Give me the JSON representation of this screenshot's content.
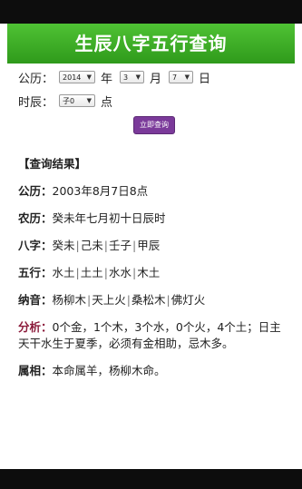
{
  "header": {
    "title": "生辰八字五行查询"
  },
  "form": {
    "calendar_label": "公历：",
    "year_value": "2014",
    "year_unit": "年",
    "month_value": "3",
    "month_unit": "月",
    "day_value": "7",
    "day_unit": "日",
    "hour_label": "时辰：",
    "hour_value": "子0",
    "hour_unit": "点",
    "query_button": "立即查询"
  },
  "result": {
    "title": "【查询结果】",
    "gongli": {
      "label": "公历：",
      "value": "2003年8月7日8点"
    },
    "nongli": {
      "label": "农历：",
      "value": "癸未年七月初十日辰时"
    },
    "bazi": {
      "label": "八字：",
      "cells": [
        "癸未",
        "己未",
        "壬子",
        "甲辰"
      ]
    },
    "wuxing": {
      "label": "五行：",
      "cells": [
        "水土",
        "土土",
        "水水",
        "木土"
      ]
    },
    "nayin": {
      "label": "纳音：",
      "cells": [
        "杨柳木",
        "天上火",
        "桑松木",
        "佛灯火"
      ]
    },
    "analysis": {
      "label": "分析：",
      "value": "0个金，1个木，3个水，0个火，4个土；日主天干水生于夏季，必须有金相助，忌木多。"
    },
    "shuxiang": {
      "label": "属相：",
      "value": "本命属羊，杨柳木命。"
    }
  },
  "colors": {
    "header_green": "#3aab25",
    "button_purple": "#7b3a9a",
    "analysis_label": "#8b1a3a"
  }
}
